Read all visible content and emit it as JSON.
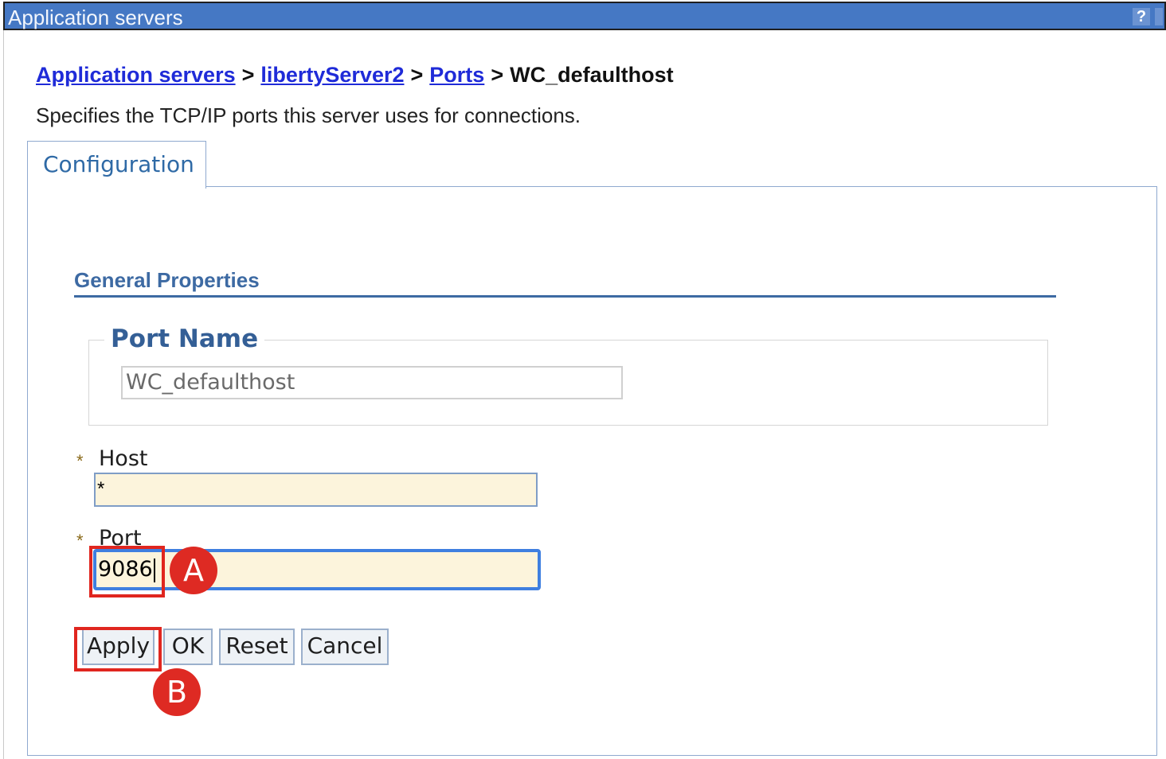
{
  "window": {
    "title": "Application servers",
    "help_icon": "?"
  },
  "breadcrumb": {
    "items": [
      "Application servers",
      "libertyServer2",
      "Ports"
    ],
    "separator": ">",
    "current": "WC_defaulthost"
  },
  "description": "Specifies the TCP/IP ports this server uses for connections.",
  "tabs": [
    {
      "label": "Configuration",
      "active": true
    }
  ],
  "general_properties": {
    "title": "General Properties",
    "port_name": {
      "label": "Port Name",
      "value": "WC_defaulthost",
      "readonly": true
    },
    "host": {
      "label": "Host",
      "value": "*",
      "required": true
    },
    "port": {
      "label": "Port",
      "value": "9086",
      "required": true,
      "focused": true
    }
  },
  "required_marker": "*",
  "buttons": {
    "apply": "Apply",
    "ok": "OK",
    "reset": "Reset",
    "cancel": "Cancel"
  },
  "annotations": {
    "a": "A",
    "b": "B"
  },
  "colors": {
    "title_bar": "#4578c4",
    "link": "#1f2bd8",
    "section_heading": "#3d6aa3",
    "required_field_bg": "#fcf4dc",
    "annotation_red": "#de2a23"
  }
}
